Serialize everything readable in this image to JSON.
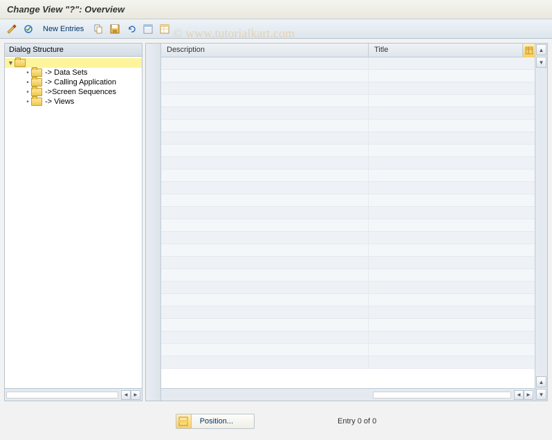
{
  "title": "Change View \"?\": Overview",
  "toolbar": {
    "new_entries": "New Entries"
  },
  "watermark": "© www.tutorialkart.com",
  "sidebar": {
    "header": "Dialog Structure",
    "root_label": "",
    "items": [
      {
        "label": "-> Data Sets"
      },
      {
        "label": "-> Calling Application"
      },
      {
        "label": "->Screen Sequences"
      },
      {
        "label": "-> Views"
      }
    ]
  },
  "grid": {
    "columns": {
      "description": "Description",
      "title": "Title"
    },
    "row_count": 25
  },
  "footer": {
    "position_label": "Position...",
    "entry_status": "Entry 0 of 0"
  }
}
